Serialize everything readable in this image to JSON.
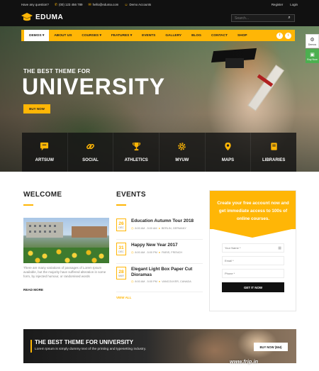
{
  "topbar": {
    "question": "Have any question?",
    "phone": "(00) 123 456 789",
    "email": "hello@eduma.com",
    "demo_accounts": "Demo Accounts",
    "register": "Register",
    "login": "Login"
  },
  "header": {
    "logo_text": "EDUMA",
    "search_placeholder": "Search..."
  },
  "nav": {
    "items": [
      {
        "label": "DEMOS ▾"
      },
      {
        "label": "ABOUT US"
      },
      {
        "label": "COURSES ▾"
      },
      {
        "label": "FEATURES ▾"
      },
      {
        "label": "EVENTS"
      },
      {
        "label": "GALLERY"
      },
      {
        "label": "BLOG"
      },
      {
        "label": "CONTACT"
      },
      {
        "label": "SHOP"
      }
    ],
    "social": [
      "f",
      "t"
    ]
  },
  "hero": {
    "subtitle": "THE BEST THEME FOR",
    "title": "UNIVERSITY",
    "button": "BUY NOW"
  },
  "categories": [
    {
      "label": "ARTSUW",
      "icon": "chat-icon"
    },
    {
      "label": "SOCIAL",
      "icon": "link-icon"
    },
    {
      "label": "ATHLETICS",
      "icon": "trophy-icon"
    },
    {
      "label": "MYUW",
      "icon": "gear-icon"
    },
    {
      "label": "MAPS",
      "icon": "map-pin-icon"
    },
    {
      "label": "LIBRARIES",
      "icon": "book-icon"
    }
  ],
  "side_widgets": {
    "demo": "Demos",
    "buy": "Buy Now"
  },
  "welcome": {
    "title": "WELCOME",
    "text": "There are many variations of passages of Lorem Ipsum available, but the majority have suffered alteration in some form, by injected humour, or randomised words",
    "read_more": "READ MORE"
  },
  "events": {
    "title": "EVENTS",
    "items": [
      {
        "day": "26",
        "month": "DEC",
        "title": "Education Autumn Tour 2018",
        "time": "8:00 AM - 5:00 AM",
        "location": "BERLIN, GERMANY"
      },
      {
        "day": "31",
        "month": "DEC",
        "title": "Happy New Year 2017",
        "time": "8:00 AM - 5:00 PM",
        "location": "PARIS, FRENCH"
      },
      {
        "day": "28",
        "month": "MAR",
        "title": "Elegant Light Box Paper Cut Dioramas",
        "time": "8:00 AM - 5:00 PM",
        "location": "VANCOUVER, CANADA"
      }
    ],
    "view_all": "VIEW ALL"
  },
  "form": {
    "heading": "Create your free account now and get immediate access to 100s of online courses.",
    "name_placeholder": "Your Name *",
    "email_placeholder": "Email *",
    "phone_placeholder": "Phone *",
    "button": "GET IT NOW"
  },
  "banner": {
    "title": "THE BEST THEME FOR UNIVERSITY",
    "subtitle": "Lorem Ipsum is simply dummy text of the printing and typesetting industry.",
    "button": "BUY NOW ($64)"
  },
  "watermark": "www.frip.in",
  "colors": {
    "accent": "#ffb606",
    "dark": "#111111"
  }
}
